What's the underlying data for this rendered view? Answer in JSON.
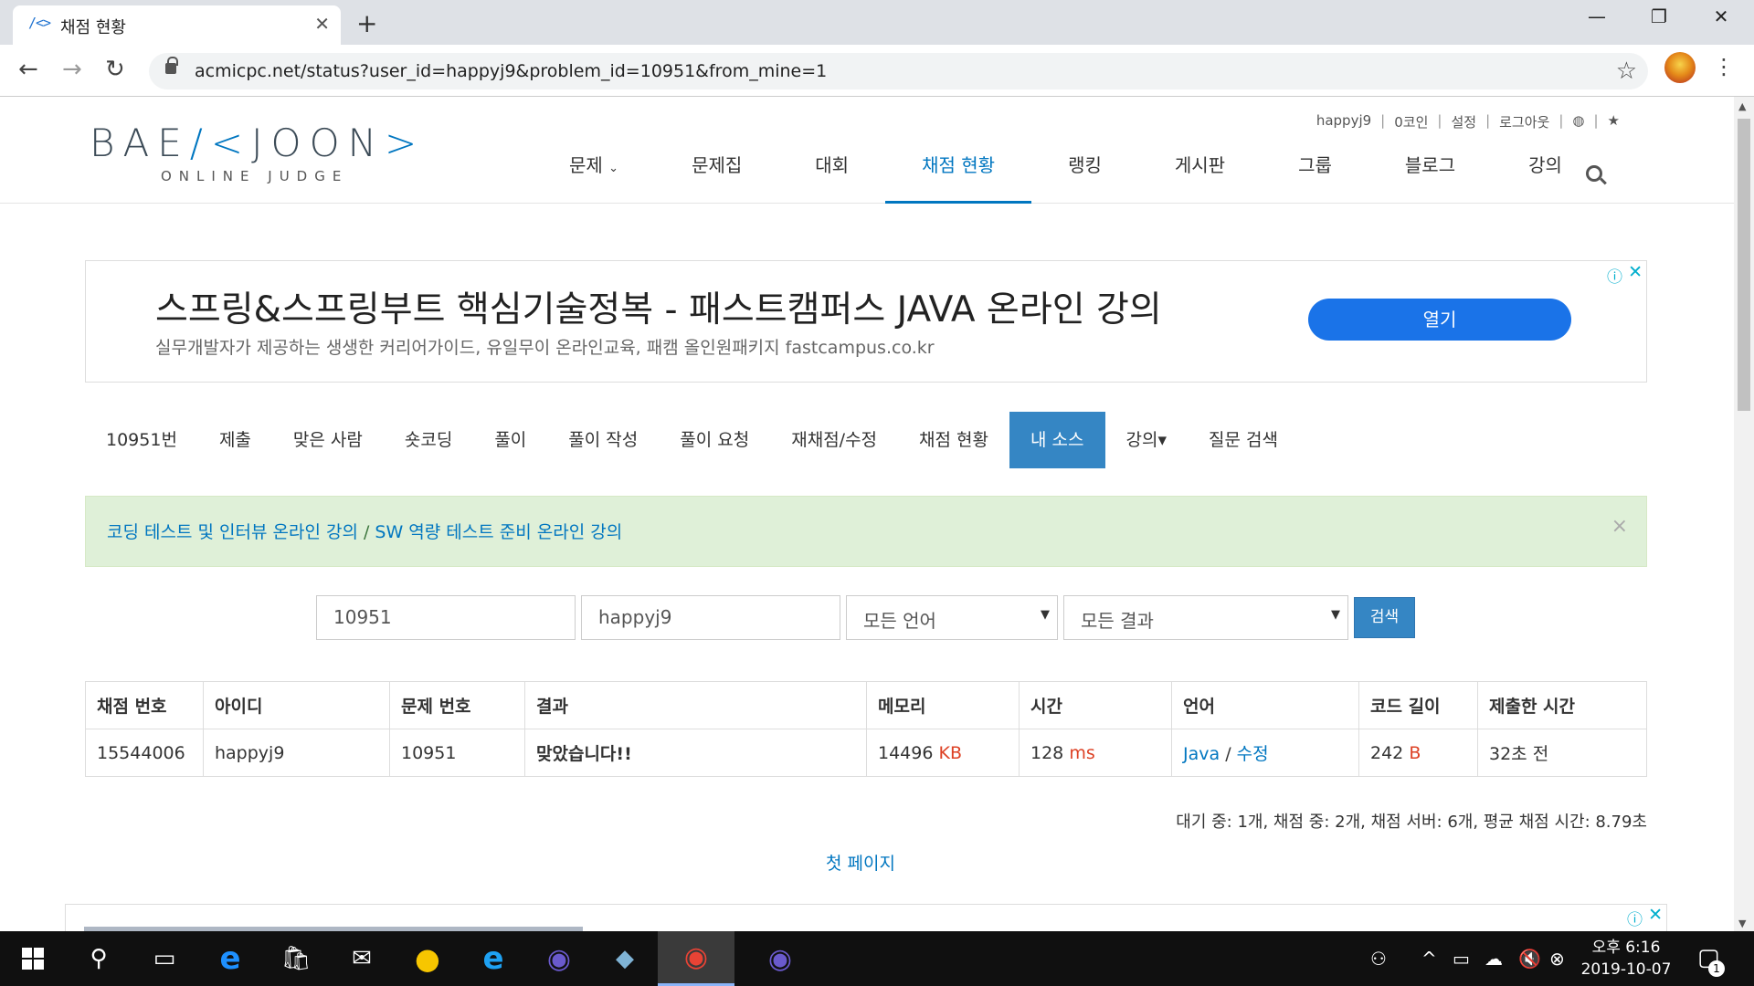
{
  "browser": {
    "tab_title": "채점 현황",
    "tab_favicon": "/<>",
    "url": "acmicpc.net/status?user_id=happyj9&problem_id=10951&from_mine=1"
  },
  "site": {
    "logo_main_1": "BAE",
    "logo_main_2": "/<",
    "logo_main_3": "JOON",
    "logo_main_4": ">",
    "logo_sub": "ONLINE JUDGE",
    "topmenu": {
      "user": "happyj9",
      "coins": "0코인",
      "settings": "설정",
      "logout": "로그아웃"
    },
    "nav": [
      "문제",
      "문제집",
      "대회",
      "채점 현황",
      "랭킹",
      "게시판",
      "그룹",
      "블로그",
      "강의"
    ]
  },
  "ad": {
    "title": "스프링&스프링부트 핵심기술정복 - 패스트캠퍼스 JAVA 온라인 강의",
    "subtitle": "실무개발자가 제공하는 생생한 커리어가이드, 유일무이 온라인교육, 패캠 올인원패키지 fastcampus.co.kr",
    "button": "열기"
  },
  "subnav": [
    "10951번",
    "제출",
    "맞은 사람",
    "숏코딩",
    "풀이",
    "풀이 작성",
    "풀이 요청",
    "재채점/수정",
    "채점 현황",
    "내 소스",
    "강의▾",
    "질문 검색"
  ],
  "alert": {
    "link1": "코딩 테스트 및 인터뷰 온라인 강의",
    "sep": "/",
    "link2": "SW 역량 테스트 준비 온라인 강의",
    "close": "×"
  },
  "filters": {
    "problem_id": "10951",
    "user_id": "happyj9",
    "language": "모든 언어",
    "result": "모든 결과",
    "search_button": "검색"
  },
  "table": {
    "headers": [
      "채점 번호",
      "아이디",
      "문제 번호",
      "결과",
      "메모리",
      "시간",
      "언어",
      "코드 길이",
      "제출한 시간"
    ],
    "rows": [
      {
        "submission_id": "15544006",
        "user": "happyj9",
        "problem": "10951",
        "result": "맞았습니다!!",
        "memory": "14496",
        "memory_unit": "KB",
        "time": "128",
        "time_unit": "ms",
        "language": "Java",
        "lang_sep": "/",
        "edit": "수정",
        "code_length": "242",
        "code_unit": "B",
        "submitted": "32초 전"
      }
    ]
  },
  "stats": "대기 중: 1개, 채점 중: 2개, 채점 서버: 6개, 평균 채점 시간: 8.79초",
  "pagination": {
    "first_page": "첫 페이지"
  },
  "taskbar": {
    "time": "오후 6:16",
    "date": "2019-10-07",
    "notifications": "1"
  }
}
